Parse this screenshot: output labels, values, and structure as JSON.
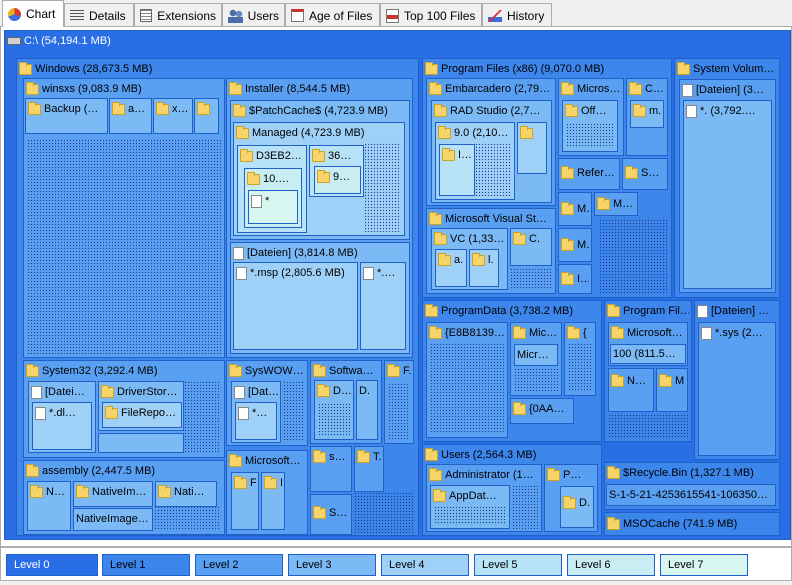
{
  "tabs": [
    {
      "label": "Chart",
      "icon": "pie-chart-icon"
    },
    {
      "label": "Details",
      "icon": "details-list-icon"
    },
    {
      "label": "Extensions",
      "icon": "extensions-icon"
    },
    {
      "label": "Users",
      "icon": "users-icon"
    },
    {
      "label": "Age of Files",
      "icon": "calendar-icon"
    },
    {
      "label": "Top 100 Files",
      "icon": "top-files-icon"
    },
    {
      "label": "History",
      "icon": "history-chart-icon"
    }
  ],
  "treemap": {
    "root": "C:\\ (54,194.1 MB)",
    "windows": "Windows (28,673.5 MB)",
    "winsxs": "winsxs (9,083.9 MB)",
    "backup": "Backup (…",
    "winsxs_a": "a…",
    "winsxs_x": "x…",
    "installer": "Installer (8,544.5 MB)",
    "patchcache": "$PatchCache$ (4,723.9 MB)",
    "managed": "Managed (4,723.9 MB)",
    "d3eb": "D3EB2…",
    "n36": "36…",
    "n10": "10.…",
    "n9": "9…",
    "star_small": "*",
    "inst_dateien": "[Dateien] (3,814.8 MB)",
    "msp": "*.msp (2,805.6 MB)",
    "msp2": "*.…",
    "system32": "System32 (3,292.4 MB)",
    "sys_dateien": "[Datei…",
    "dl": "*.dl…",
    "driverstore": "DriverStor…",
    "filerepo": "FileRepo…",
    "syswow": "SysWOW…",
    "sw_dateien": "[Dat…",
    "sw_star": "*…",
    "softwa": "Softwa…",
    "softwa_d": "D…",
    "softwa_d2": "D.",
    "win_f": "F.",
    "microsoft_w": "Microsoft…",
    "ms_f": "F",
    "ms_i": "I",
    "win_s": "s…",
    "win_t": "T.",
    "win_s2": "S…",
    "assembly": "assembly (2,447.5 MB)",
    "asm_n": "N…",
    "nativeim1": "NativeIm…",
    "nati": "Nati…",
    "nativeimage": "NativeImage…",
    "progx86": "Program Files (x86) (9,070.0 MB)",
    "embarcadero": "Embarcadero (2,79…",
    "radstudio": "RAD Studio (2,7…",
    "n90": "9.0 (2,10…",
    "rs_i": "I…",
    "micros_top": "Micros…",
    "off": "Off…",
    "c_top": "C…",
    "m_top": "m.",
    "refer": "Refer…",
    "s_ref": "S…",
    "msvisual": "Microsoft Visual St…",
    "vc": "VC (1,33…",
    "vc_a": "a.",
    "vc_l": "l.",
    "c_vs": "C.",
    "m1": "M…",
    "m2": "M…",
    "m3": "M…",
    "i_last": "I…",
    "sysvol": "System Volum…",
    "sv_dateien": "[Dateien] (3…",
    "sv_star": "*. (3,792.…",
    "programdata": "ProgramData (3,738.2 MB)",
    "e8b8": "{E8B8139…",
    "mic": "Mic…",
    "pd_brace": "{",
    "micr": "Micr…",
    "n0aa": "{0AA…",
    "progfil": "Program Fil…",
    "microsoft_pf": "Microsoft…",
    "n100": "100 (811.5…",
    "pf_n": "N…",
    "pf_m": "M.",
    "r_dateien": "[Dateien] …",
    "sys_file": "*.sys (2…",
    "users": "Users (2,564.3 MB)",
    "administrator": "Administrator (1…",
    "appdat": "AppDat…",
    "u_p": "P…",
    "u_d": "D.",
    "recycle": "$Recycle.Bin (1,327.1 MB)",
    "sid": "S-1-5-21-4253615541-106350…",
    "msocache": "MSOCache (741.9 MB)"
  },
  "legend": [
    "Level 0",
    "Level 1",
    "Level 2",
    "Level 3",
    "Level 4",
    "Level 5",
    "Level 6",
    "Level 7"
  ],
  "colors": {
    "level0": "#2a6ee6",
    "level1": "#3d86ec",
    "level2": "#5aa0f2",
    "level3": "#7bbaf5",
    "level4": "#9fd0f7",
    "level5": "#b8e2f7",
    "level6": "#c8eef4",
    "level7": "#d8f6f0"
  }
}
